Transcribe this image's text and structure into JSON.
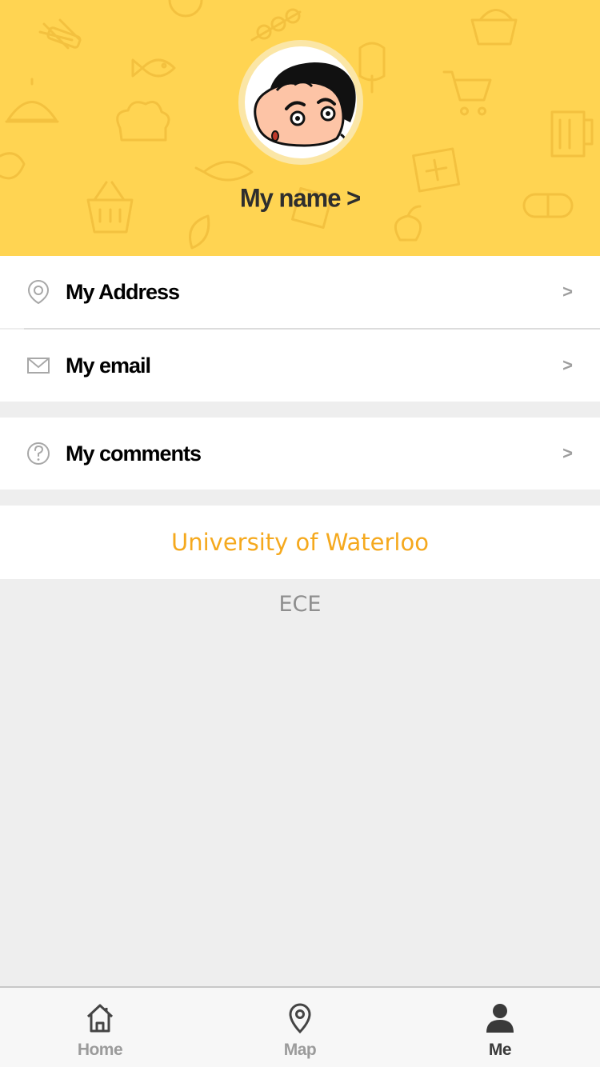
{
  "header": {
    "name_label": "My name >",
    "background_color": "#ffd452"
  },
  "menu": {
    "items": [
      {
        "label": "My Address",
        "icon": "location-pin-icon",
        "chevron": ">"
      },
      {
        "label": "My email",
        "icon": "envelope-icon",
        "chevron": ">"
      },
      {
        "label": "My comments",
        "icon": "question-circle-icon",
        "chevron": ">"
      }
    ]
  },
  "footer_info": {
    "university": "University of Waterloo",
    "university_color": "#f5a91e",
    "department": "ECE"
  },
  "tabbar": {
    "tabs": [
      {
        "label": "Home",
        "icon": "home-icon",
        "active": false
      },
      {
        "label": "Map",
        "icon": "map-pin-icon",
        "active": false
      },
      {
        "label": "Me",
        "icon": "person-icon",
        "active": true
      }
    ]
  }
}
